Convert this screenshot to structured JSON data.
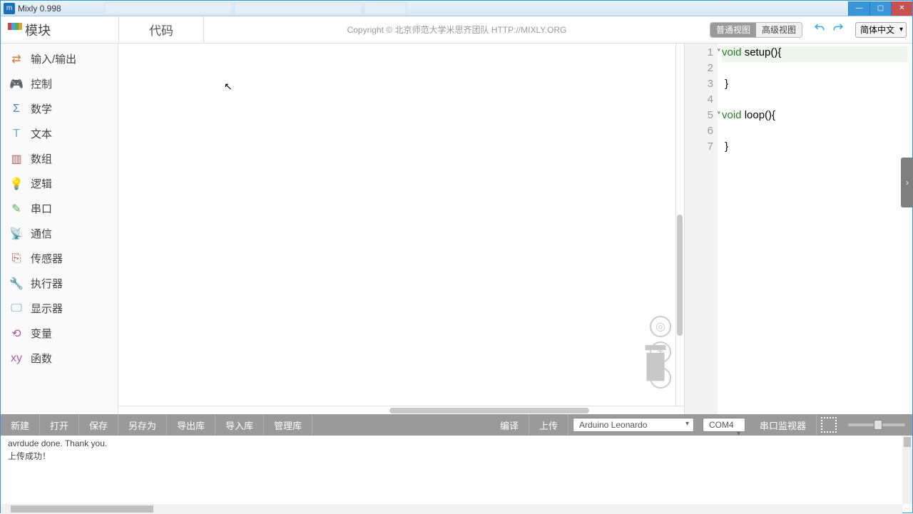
{
  "window": {
    "title": "Mixly 0.998",
    "icon_text": "m"
  },
  "toprow": {
    "blocks_label": "模块",
    "code_label": "代码",
    "copyright": "Copyright © 北京师范大学米思齐团队 HTTP://MIXLY.ORG",
    "view_normal": "普通视图",
    "view_advanced": "高级视图",
    "lang": "简体中文"
  },
  "sidebar": {
    "items": [
      {
        "label": "输入/输出",
        "color": "#d08234"
      },
      {
        "label": "控制",
        "color": "#5aa75a"
      },
      {
        "label": "数学",
        "color": "#4f7fc1"
      },
      {
        "label": "文本",
        "color": "#6aaed0"
      },
      {
        "label": "数组",
        "color": "#b05a5a"
      },
      {
        "label": "逻辑",
        "color": "#4f9fe3"
      },
      {
        "label": "串口",
        "color": "#4fb04f"
      },
      {
        "label": "通信",
        "color": "#5aa75a"
      },
      {
        "label": "传感器",
        "color": "#b05a5a"
      },
      {
        "label": "执行器",
        "color": "#4fb04f"
      },
      {
        "label": "显示器",
        "color": "#5aa7b0"
      },
      {
        "label": "变量",
        "color": "#a05aa0"
      },
      {
        "label": "函数",
        "color": "#b05aa0"
      }
    ]
  },
  "code": {
    "lines": [
      {
        "n": "1",
        "kw": "void",
        "rest": " setup(){",
        "fold": true,
        "hl": true
      },
      {
        "n": "2",
        "kw": "",
        "rest": ""
      },
      {
        "n": "3",
        "kw": "",
        "rest": " }"
      },
      {
        "n": "4",
        "kw": "",
        "rest": ""
      },
      {
        "n": "5",
        "kw": "void",
        "rest": " loop(){",
        "fold": true
      },
      {
        "n": "6",
        "kw": "",
        "rest": ""
      },
      {
        "n": "7",
        "kw": "",
        "rest": " }"
      }
    ]
  },
  "bottombar": {
    "new": "新建",
    "open": "打开",
    "save": "保存",
    "saveas": "另存为",
    "export": "导出库",
    "import": "导入库",
    "manage": "管理库",
    "compile": "编译",
    "upload": "上传",
    "board": "Arduino Leonardo",
    "port": "COM4",
    "serial": "串口监视器"
  },
  "console": {
    "lines": [
      "avrdude done.  Thank you.",
      "",
      "上传成功！"
    ]
  }
}
